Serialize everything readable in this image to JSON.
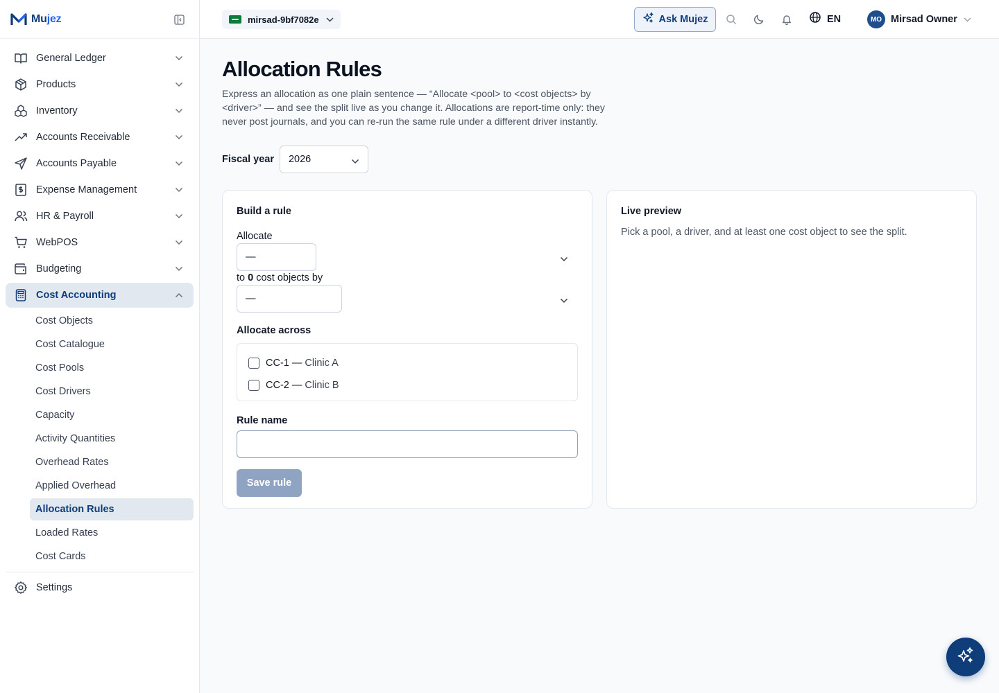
{
  "brand": {
    "name_main": "Mu",
    "name_accent": "jez"
  },
  "sidebar": {
    "items": [
      {
        "label": "General Ledger",
        "icon": "book-icon"
      },
      {
        "label": "Products",
        "icon": "box-icon"
      },
      {
        "label": "Inventory",
        "icon": "boxes-icon"
      },
      {
        "label": "Accounts Receivable",
        "icon": "trend-up-icon"
      },
      {
        "label": "Accounts Payable",
        "icon": "send-icon"
      },
      {
        "label": "Expense Management",
        "icon": "receipt-icon"
      },
      {
        "label": "HR & Payroll",
        "icon": "users-icon"
      },
      {
        "label": "WebPOS",
        "icon": "cart-icon"
      },
      {
        "label": "Budgeting",
        "icon": "wallet-icon"
      },
      {
        "label": "Cost Accounting",
        "icon": "calculator-icon"
      }
    ],
    "cost_accounting_sub": [
      "Cost Objects",
      "Cost Catalogue",
      "Cost Pools",
      "Cost Drivers",
      "Capacity",
      "Activity Quantities",
      "Overhead Rates",
      "Applied Overhead",
      "Allocation Rules",
      "Loaded Rates",
      "Cost Cards"
    ],
    "settings_label": "Settings"
  },
  "topbar": {
    "tenant": "mirsad-9bf7082e",
    "ask_label": "Ask Mujez",
    "language": "EN",
    "user_initials": "MO",
    "user_name": "Mirsad Owner"
  },
  "page": {
    "title": "Allocation Rules",
    "description": "Express an allocation as one plain sentence — “Allocate <pool> to <cost objects> by <driver>” — and see the split live as you change it. Allocations are report-time only: they never post journals, and you can re-run the same rule under a different driver instantly.",
    "fiscal_year_label": "Fiscal year",
    "fiscal_year_value": "2026"
  },
  "builder": {
    "title": "Build a rule",
    "allocate_label": "Allocate",
    "pool_value": "—",
    "to_prefix": "to ",
    "cost_object_count": "0",
    "to_suffix": " cost objects by",
    "driver_value": "—",
    "across_label": "Allocate across",
    "options": [
      {
        "code": "CC-1",
        "sep": " — ",
        "name": "Clinic A",
        "checked": false
      },
      {
        "code": "CC-2",
        "sep": " — ",
        "name": "Clinic B",
        "checked": false
      }
    ],
    "rule_name_label": "Rule name",
    "rule_name_value": "",
    "save_label": "Save rule"
  },
  "preview": {
    "title": "Live preview",
    "empty_text": "Pick a pool, a driver, and at least one cost object to see the split."
  },
  "colors": {
    "primary": "#0f3d7a",
    "accent": "#2563eb",
    "active_bg": "#e2e8f0",
    "disabled_button": "#8fa4c2"
  }
}
